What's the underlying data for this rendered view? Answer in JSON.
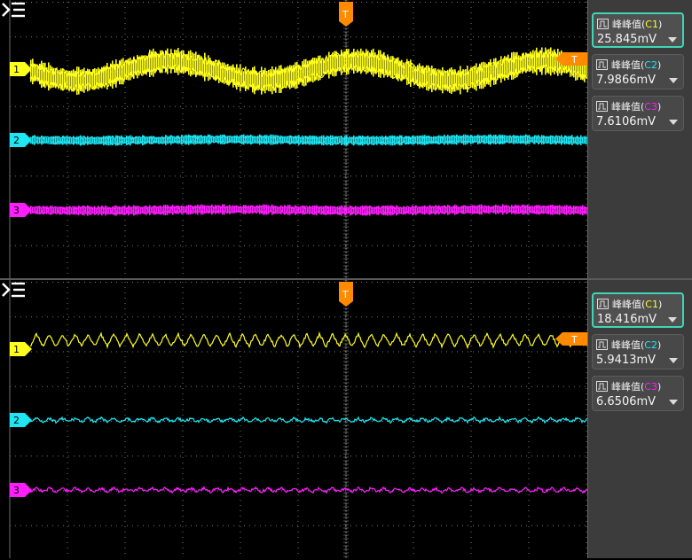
{
  "colors": {
    "c1": "#ffff1e",
    "c2": "#1ee6f2",
    "c3": "#ff1eff",
    "trigger": "#ff8a00",
    "grid": "#7a7a7a",
    "accent": "#3fd6b8"
  },
  "panels": [
    {
      "channel_markers": [
        "1",
        "2",
        "3"
      ],
      "trigger_label": "T",
      "menu_icon": "menu-collapse-icon",
      "measurements": [
        {
          "label": "峰峰值(",
          "src": "C1",
          "close": ")",
          "value": "25.845mV",
          "color": "#ffff1e",
          "active": true
        },
        {
          "label": "峰峰值(",
          "src": "C2",
          "close": ")",
          "value": "7.9866mV",
          "color": "#1ee6f2",
          "active": false
        },
        {
          "label": "峰峰值(",
          "src": "C3",
          "close": ")",
          "value": "7.6106mV",
          "color": "#ff1eff",
          "active": false
        }
      ]
    },
    {
      "channel_markers": [
        "1",
        "2",
        "3"
      ],
      "trigger_label": "T",
      "menu_icon": "menu-collapse-icon",
      "measurements": [
        {
          "label": "峰峰值(",
          "src": "C1",
          "close": ")",
          "value": "18.416mV",
          "color": "#ffff1e",
          "active": true
        },
        {
          "label": "峰峰值(",
          "src": "C2",
          "close": ")",
          "value": "5.9413mV",
          "color": "#1ee6f2",
          "active": false
        },
        {
          "label": "峰峰值(",
          "src": "C3",
          "close": ")",
          "value": "6.6506mV",
          "color": "#ff1eff",
          "active": false
        }
      ]
    }
  ]
}
